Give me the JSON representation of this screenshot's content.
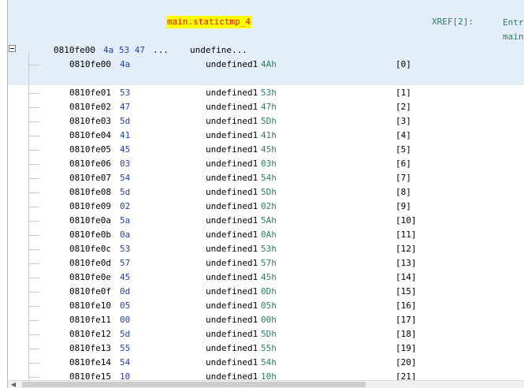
{
  "header": {
    "label": "main.statictmp_4",
    "xref_label": "XREF[2]:",
    "xref_targets": [
      "Entr",
      "main"
    ]
  },
  "struct_row": {
    "address": "0810fe00",
    "bytes": "4a 53 47",
    "ellipsis": "...",
    "mnemonic": "undefine..."
  },
  "rows": [
    {
      "address": "0810fe00",
      "byte": "4a",
      "mnemonic": "undefined1",
      "operand": "4Ah",
      "index": "[0]"
    },
    {
      "address": "0810fe01",
      "byte": "53",
      "mnemonic": "undefined1",
      "operand": "53h",
      "index": "[1]"
    },
    {
      "address": "0810fe02",
      "byte": "47",
      "mnemonic": "undefined1",
      "operand": "47h",
      "index": "[2]"
    },
    {
      "address": "0810fe03",
      "byte": "5d",
      "mnemonic": "undefined1",
      "operand": "5Dh",
      "index": "[3]"
    },
    {
      "address": "0810fe04",
      "byte": "41",
      "mnemonic": "undefined1",
      "operand": "41h",
      "index": "[4]"
    },
    {
      "address": "0810fe05",
      "byte": "45",
      "mnemonic": "undefined1",
      "operand": "45h",
      "index": "[5]"
    },
    {
      "address": "0810fe06",
      "byte": "03",
      "mnemonic": "undefined1",
      "operand": "03h",
      "index": "[6]"
    },
    {
      "address": "0810fe07",
      "byte": "54",
      "mnemonic": "undefined1",
      "operand": "54h",
      "index": "[7]"
    },
    {
      "address": "0810fe08",
      "byte": "5d",
      "mnemonic": "undefined1",
      "operand": "5Dh",
      "index": "[8]"
    },
    {
      "address": "0810fe09",
      "byte": "02",
      "mnemonic": "undefined1",
      "operand": "02h",
      "index": "[9]"
    },
    {
      "address": "0810fe0a",
      "byte": "5a",
      "mnemonic": "undefined1",
      "operand": "5Ah",
      "index": "[10]"
    },
    {
      "address": "0810fe0b",
      "byte": "0a",
      "mnemonic": "undefined1",
      "operand": "0Ah",
      "index": "[11]"
    },
    {
      "address": "0810fe0c",
      "byte": "53",
      "mnemonic": "undefined1",
      "operand": "53h",
      "index": "[12]"
    },
    {
      "address": "0810fe0d",
      "byte": "57",
      "mnemonic": "undefined1",
      "operand": "57h",
      "index": "[13]"
    },
    {
      "address": "0810fe0e",
      "byte": "45",
      "mnemonic": "undefined1",
      "operand": "45h",
      "index": "[14]"
    },
    {
      "address": "0810fe0f",
      "byte": "0d",
      "mnemonic": "undefined1",
      "operand": "0Dh",
      "index": "[15]"
    },
    {
      "address": "0810fe10",
      "byte": "05",
      "mnemonic": "undefined1",
      "operand": "05h",
      "index": "[16]"
    },
    {
      "address": "0810fe11",
      "byte": "00",
      "mnemonic": "undefined1",
      "operand": "00h",
      "index": "[17]"
    },
    {
      "address": "0810fe12",
      "byte": "5d",
      "mnemonic": "undefined1",
      "operand": "5Dh",
      "index": "[18]"
    },
    {
      "address": "0810fe13",
      "byte": "55",
      "mnemonic": "undefined1",
      "operand": "55h",
      "index": "[19]"
    },
    {
      "address": "0810fe14",
      "byte": "54",
      "mnemonic": "undefined1",
      "operand": "54h",
      "index": "[20]"
    },
    {
      "address": "0810fe15",
      "byte": "10",
      "mnemonic": "undefined1",
      "operand": "10h",
      "index": "[21]"
    }
  ],
  "icons": {
    "collapse": "collapse-minus-icon",
    "scroll_left": "scroll-left-arrow-icon"
  },
  "colors": {
    "label_bg": "#ffff00",
    "label_fg": "#ff0000",
    "byte": "#1e3fb4",
    "operand": "#2a7f5a",
    "header_bg": "#e4eef8"
  }
}
